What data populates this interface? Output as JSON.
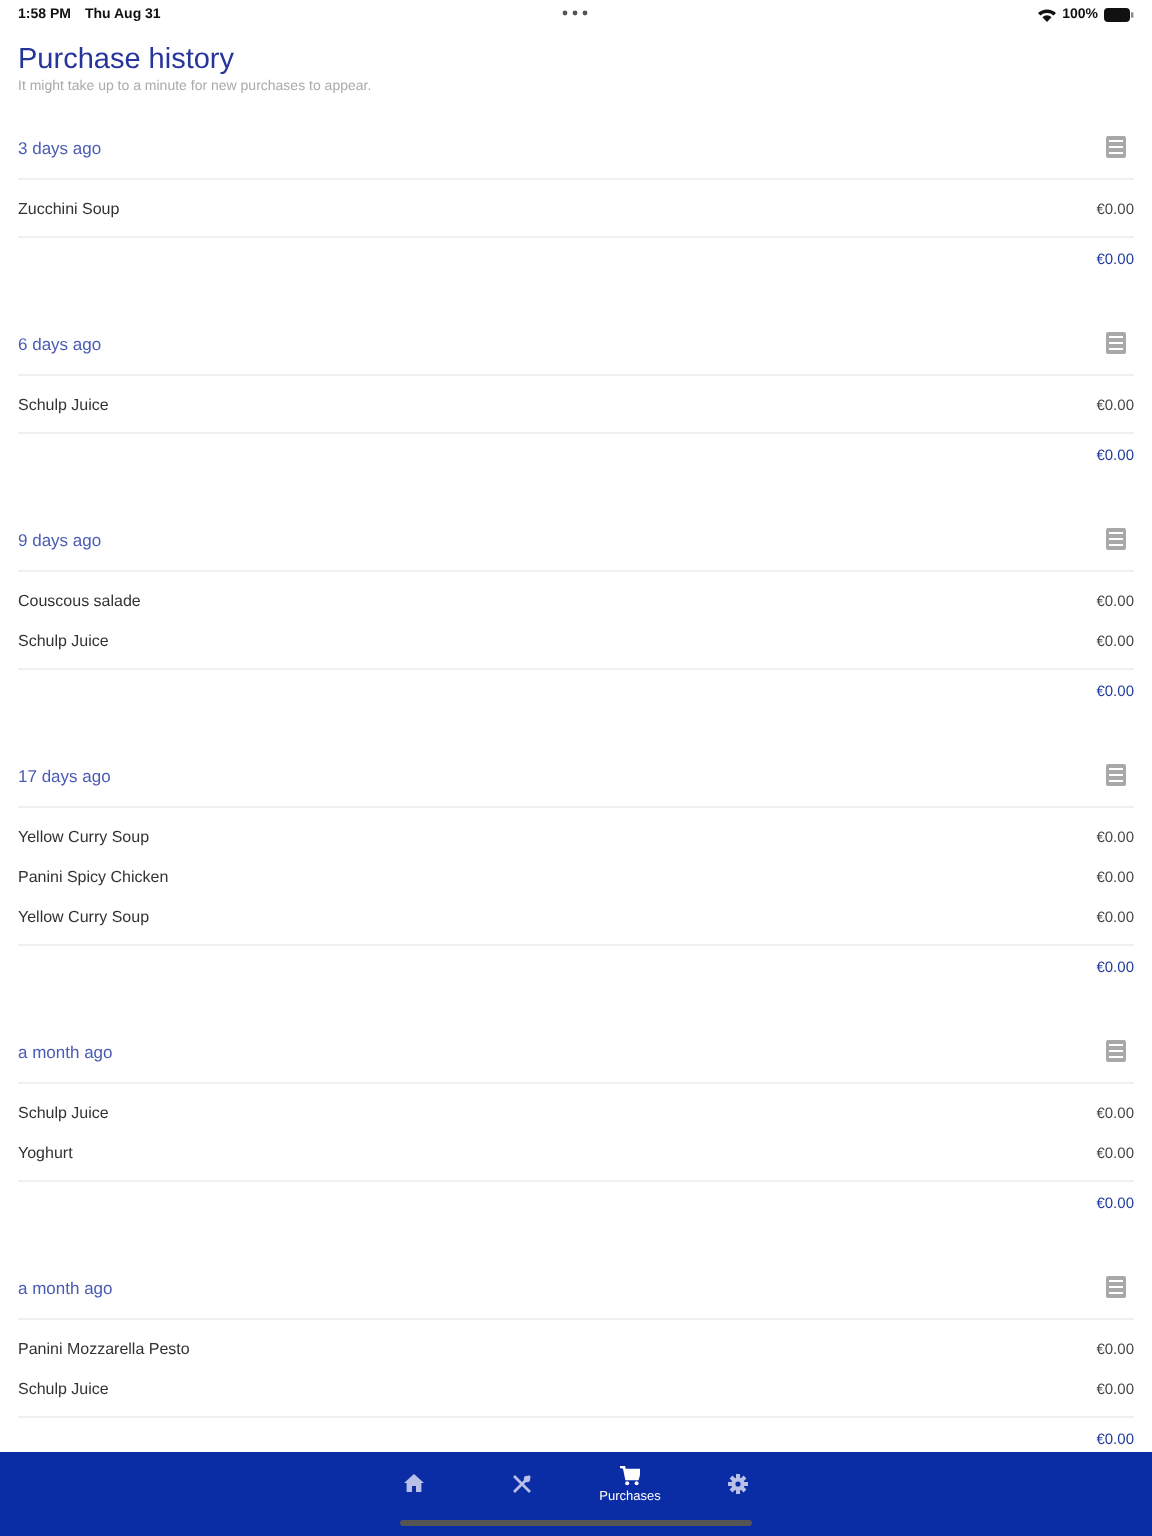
{
  "status_bar": {
    "time": "1:58 PM",
    "date": "Thu Aug 31",
    "battery": "100%"
  },
  "title": "Purchase history",
  "subtitle": "It might take up to a minute for new purchases to appear.",
  "groups": [
    {
      "when": "3 days ago",
      "items": [
        {
          "name": "Zucchini Soup",
          "price": "€0.00"
        }
      ],
      "total": "€0.00"
    },
    {
      "when": "6 days ago",
      "items": [
        {
          "name": "Schulp Juice",
          "price": "€0.00"
        }
      ],
      "total": "€0.00"
    },
    {
      "when": "9 days ago",
      "items": [
        {
          "name": "Couscous salade",
          "price": "€0.00"
        },
        {
          "name": "Schulp Juice",
          "price": "€0.00"
        }
      ],
      "total": "€0.00"
    },
    {
      "when": "17 days ago",
      "items": [
        {
          "name": "Yellow Curry Soup",
          "price": "€0.00"
        },
        {
          "name": "Panini Spicy Chicken",
          "price": "€0.00"
        },
        {
          "name": "Yellow Curry Soup",
          "price": "€0.00"
        }
      ],
      "total": "€0.00"
    },
    {
      "when": "a month ago",
      "items": [
        {
          "name": "Schulp Juice",
          "price": "€0.00"
        },
        {
          "name": "Yoghurt",
          "price": "€0.00"
        }
      ],
      "total": "€0.00"
    },
    {
      "when": "a month ago",
      "items": [
        {
          "name": "Panini Mozzarella Pesto",
          "price": "€0.00"
        },
        {
          "name": "Schulp Juice",
          "price": "€0.00"
        }
      ],
      "total": "€0.00"
    }
  ],
  "tabs": [
    {
      "kind": "home",
      "selected": false
    },
    {
      "kind": "cutlery",
      "selected": false
    },
    {
      "kind": "cart",
      "label": "Purchases",
      "selected": true
    },
    {
      "kind": "gear",
      "selected": false
    }
  ]
}
